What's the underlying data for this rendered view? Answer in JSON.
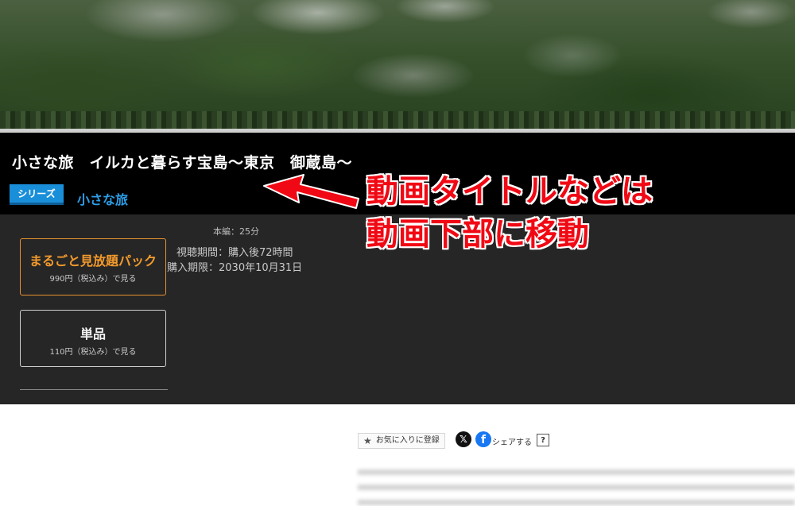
{
  "video": {
    "title": "小さな旅　イルカと暮らす宝島～東京　御蔵島～",
    "series_badge": "シリーズ",
    "series_name": "小さな旅",
    "runtime": "本編：25分",
    "viewing_period": "視聴期間：購入後72時間",
    "purchase_deadline": "購入期限：2030年10月31日"
  },
  "plans": [
    {
      "title": "まるごと見放題パック",
      "price": "990円（税込み）で見る",
      "accent": "#f39a2c"
    },
    {
      "title": "単品",
      "price": "110円（税込み）で見る"
    }
  ],
  "actions": {
    "favorite_label": "お気に入りに登録",
    "share_label": "シェアする",
    "help_label": "?",
    "x_icon": "x-logo-icon",
    "facebook_icon": "facebook-logo-icon"
  },
  "annotation": {
    "line1": "動画タイトルなどは",
    "line2": "動画下部に移動",
    "color": "#f00914"
  },
  "colors": {
    "series_blue": "#1a8fd9",
    "panel_bg": "#262626"
  }
}
